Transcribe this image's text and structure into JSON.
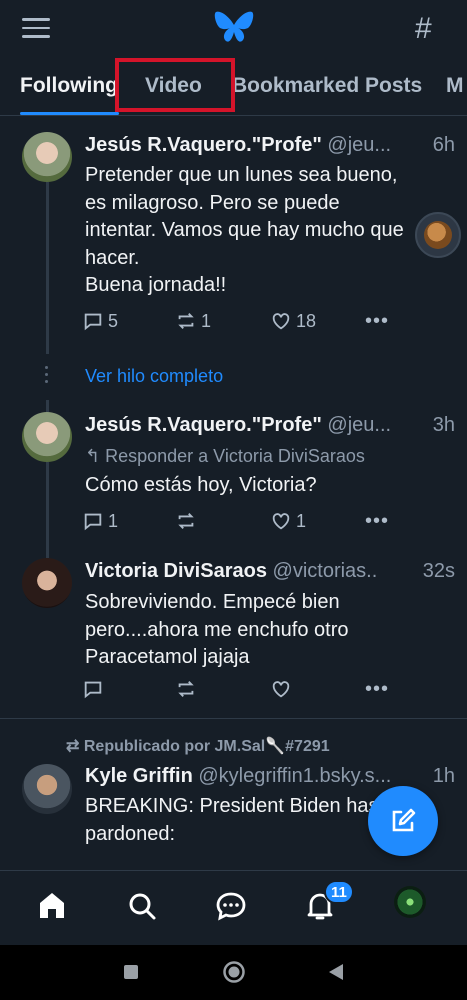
{
  "header": {
    "menu_icon": "menu-icon",
    "logo_icon": "butterfly-logo-icon",
    "feeds_icon": "hash-icon",
    "feeds_glyph": "#"
  },
  "tabs": [
    {
      "label": "Following",
      "active": true
    },
    {
      "label": "Video",
      "active": false
    },
    {
      "label": "Bookmarked Posts",
      "active": false
    },
    {
      "label": "M",
      "active": false
    }
  ],
  "highlight_color": "#d4142a",
  "accent_color": "#208bfe",
  "posts": [
    {
      "name": "Jesús R.Vaquero.\"Profe\"",
      "handle": "@jeu...",
      "time": "6h",
      "lines": [
        "Pretender que un lunes sea bueno,",
        "es milagroso. Pero se puede",
        "intentar. Vamos que hay mucho que",
        "hacer.",
        "Buena jornada!!"
      ],
      "replies": "5",
      "reposts": "1",
      "likes": "18"
    },
    {
      "name": "Jesús R.Vaquero.\"Profe\"",
      "handle": "@jeu...",
      "time": "3h",
      "reply_to": "Responder a Victoria DiviSaraos",
      "lines": [
        "Cómo estás hoy, Victoria?"
      ],
      "replies": "1",
      "reposts": "",
      "likes": "1"
    },
    {
      "name": "Victoria DiviSaraos",
      "handle": "@victorias..",
      "time": "32s",
      "lines": [
        "Sobreviviendo. Empecé bien",
        "pero....ahora me enchufo otro",
        "Paracetamol jajaja"
      ],
      "replies": "",
      "reposts": "",
      "likes": ""
    },
    {
      "repost_by": "Republicado por JM.Sal🥄#7291",
      "name": "Kyle Griffin",
      "handle": "@kylegriffin1.bsky.s...",
      "time": "1h",
      "lines": [
        "BREAKING: President Biden has",
        "pardoned:"
      ]
    }
  ],
  "full_thread_label": "Ver hilo completo",
  "more_glyph": "•••",
  "bottom_nav": {
    "items": [
      "home-icon",
      "search-icon",
      "chat-icon",
      "bell-icon",
      "profile-avatar"
    ],
    "notification_count": "11"
  },
  "compose_icon": "compose-icon"
}
